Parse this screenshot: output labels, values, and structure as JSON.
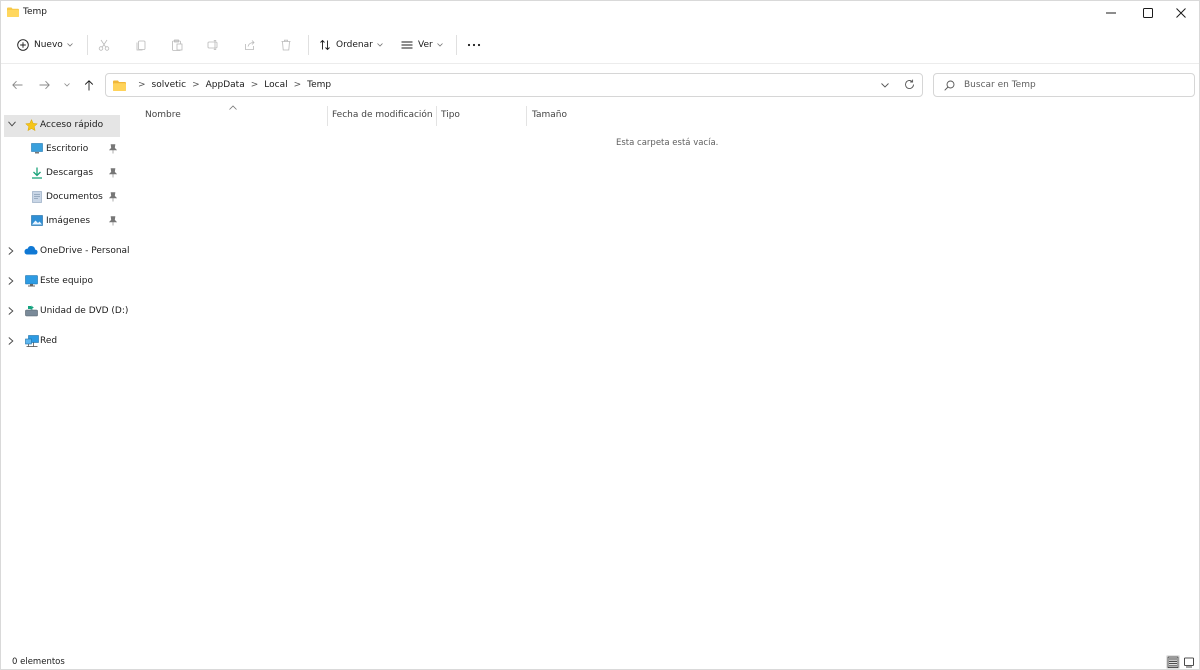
{
  "window": {
    "title": "Temp"
  },
  "toolbar": {
    "new_label": "Nuevo",
    "sort_label": "Ordenar",
    "view_label": "Ver"
  },
  "address": {
    "path": [
      "solvetic",
      "AppData",
      "Local",
      "Temp"
    ],
    "separator": ">"
  },
  "search": {
    "placeholder": "Buscar en Temp"
  },
  "sidebar": {
    "quick_access": "Acceso rápido",
    "pinned": [
      "Escritorio",
      "Descargas",
      "Documentos",
      "Imágenes"
    ],
    "onedrive": "OneDrive - Personal",
    "this_pc": "Este equipo",
    "dvd": "Unidad de DVD (D:)",
    "network": "Red"
  },
  "columns": {
    "name": "Nombre",
    "modified": "Fecha de modificación",
    "type": "Tipo",
    "size": "Tamaño"
  },
  "content": {
    "empty_message": "Esta carpeta está vacía."
  },
  "status": {
    "count": "0 elementos"
  },
  "colors": {
    "folder": "#f7c948",
    "accent": "#0067c0",
    "selected": "#e5e5e5"
  }
}
